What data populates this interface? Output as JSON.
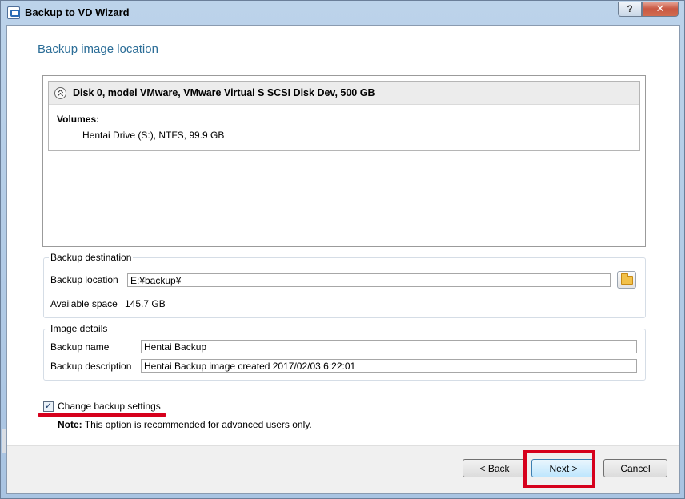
{
  "window": {
    "title": "Backup to VD Wizard",
    "help_label": "?",
    "close_label": "✕"
  },
  "page": {
    "heading": "Backup image location"
  },
  "disk": {
    "title": "Disk 0, model VMware, VMware Virtual S SCSI Disk Dev, 500 GB",
    "volumes_label": "Volumes:",
    "volumes": [
      "Hentai Drive (S:), NTFS, 99.9 GB"
    ]
  },
  "destination": {
    "group_title": "Backup destination",
    "location_label": "Backup location",
    "location_value": "E:¥backup¥",
    "available_label": "Available space",
    "available_value": "145.7 GB"
  },
  "image_details": {
    "group_title": "Image details",
    "name_label": "Backup name",
    "name_value": "Hentai Backup",
    "description_label": "Backup description",
    "description_value": "Hentai Backup image created 2017/02/03 6:22:01"
  },
  "options": {
    "change_settings_label": "Change backup settings",
    "change_settings_checked": true,
    "check_mark": "✓",
    "note_bold": "Note:",
    "note_text": " This option is recommended for advanced users only."
  },
  "buttons": {
    "back": "< Back",
    "next": "Next >",
    "cancel": "Cancel"
  },
  "colors": {
    "heading": "#2b6d97",
    "highlight": "#d6001c"
  }
}
